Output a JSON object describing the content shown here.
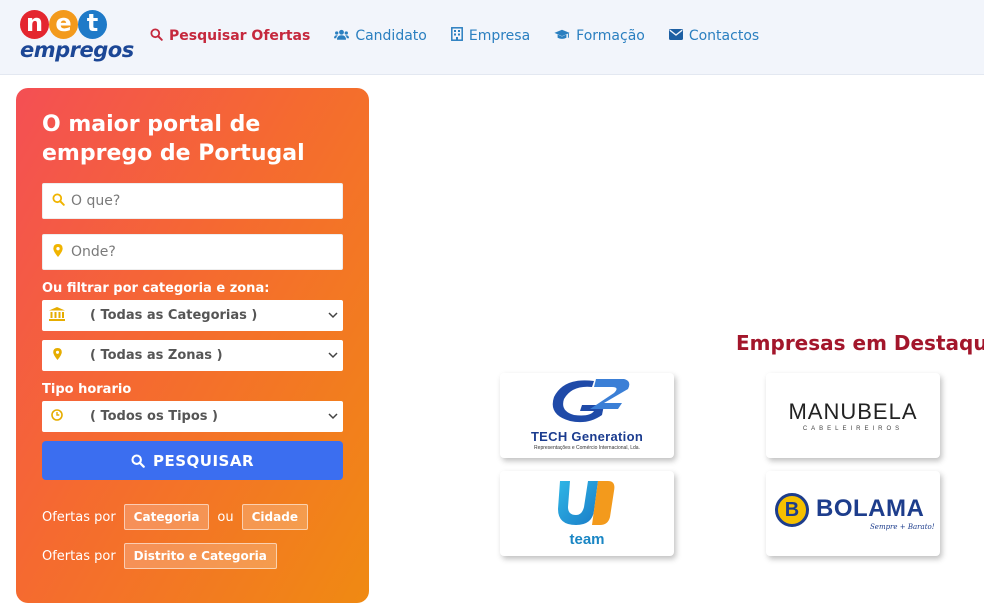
{
  "logo": {
    "letters": [
      "n",
      "e",
      "t"
    ],
    "word": "empregos"
  },
  "nav": [
    {
      "label": "Pesquisar Ofertas",
      "icon": "search-icon",
      "active": true
    },
    {
      "label": "Candidato",
      "icon": "users-icon"
    },
    {
      "label": "Empresa",
      "icon": "building-icon"
    },
    {
      "label": "Formação",
      "icon": "graduation-cap-icon"
    },
    {
      "label": "Contactos",
      "icon": "envelope-icon"
    }
  ],
  "search": {
    "title": "O maior portal de emprego de Portugal",
    "what_placeholder": "O que?",
    "where_placeholder": "Onde?",
    "filter_label": "Ou filtrar por categoria e zona:",
    "category_value": "( Todas as Categorias )",
    "zone_value": "( Todas as Zonas )",
    "schedule_label": "Tipo horario",
    "schedule_value": "( Todos os Tipos )",
    "button_label": "PESQUISAR",
    "offers_by_label": "Ofertas por",
    "chip_category": "Categoria",
    "or_label": "ou",
    "chip_city": "Cidade",
    "chip_district_category": "Distrito e Categoria"
  },
  "featured": {
    "title": "Empresas em Destaque",
    "companies": [
      {
        "name": "TECH Generation",
        "subtitle": "Representações e Comércio Internacional, Lda."
      },
      {
        "name": "MANUBELA",
        "subtitle": "CABELEIREIROS"
      },
      {
        "name": "team"
      },
      {
        "name": "BOLAMA",
        "subtitle": "Sempre + Barato!"
      }
    ]
  },
  "colors": {
    "accent_red": "#c5283d",
    "nav_blue": "#2a7fc0",
    "button_blue": "#3b6ef0",
    "panel_gradient_start": "#f44f54",
    "panel_gradient_end": "#f08a12",
    "featured_title": "#a3162b"
  }
}
